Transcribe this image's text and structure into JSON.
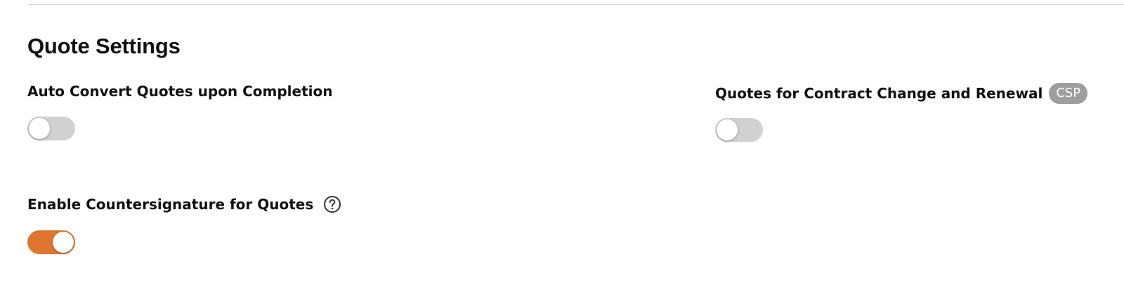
{
  "section": {
    "title": "Quote Settings"
  },
  "settings": {
    "auto_convert": {
      "label": "Auto Convert Quotes upon Completion",
      "enabled": false
    },
    "contract_change": {
      "label": "Quotes for Contract Change and Renewal",
      "badge": "CSP",
      "enabled": false
    },
    "countersignature": {
      "label": "Enable Countersignature for Quotes",
      "help_icon": "question-circle-icon",
      "enabled": true
    }
  },
  "colors": {
    "toggle_on": "#e07530",
    "toggle_off": "#d1d1d1",
    "badge_bg": "#9e9e9e"
  }
}
